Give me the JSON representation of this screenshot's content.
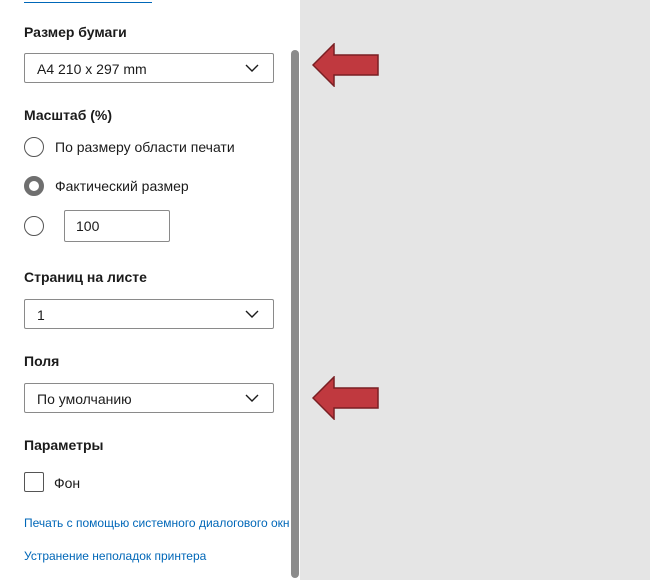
{
  "paper_size": {
    "label": "Размер бумаги",
    "value": "A4 210 x 297 mm"
  },
  "scale": {
    "label": "Масштаб (%)",
    "options": [
      {
        "label": "По размеру области печати",
        "checked": false
      },
      {
        "label": "Фактический размер",
        "checked": true
      },
      {
        "label": "",
        "checked": false
      }
    ],
    "custom_value": "100"
  },
  "pages_per_sheet": {
    "label": "Страниц на листе",
    "value": "1"
  },
  "margins": {
    "label": "Поля",
    "value": "По умолчанию"
  },
  "options": {
    "label": "Параметры",
    "background_label": "Фон",
    "background_checked": false
  },
  "links": {
    "system_dialog": "Печать с помощью системного диалогового окн",
    "troubleshoot": "Устранение неполадок принтера"
  },
  "colors": {
    "accent": "#0067b8",
    "annotation_arrow": "#c0393f",
    "preview_bg": "#e5e5e5"
  },
  "icons": {
    "dropdown": "chevron-down-icon",
    "annotation": "arrow-left-icon"
  }
}
